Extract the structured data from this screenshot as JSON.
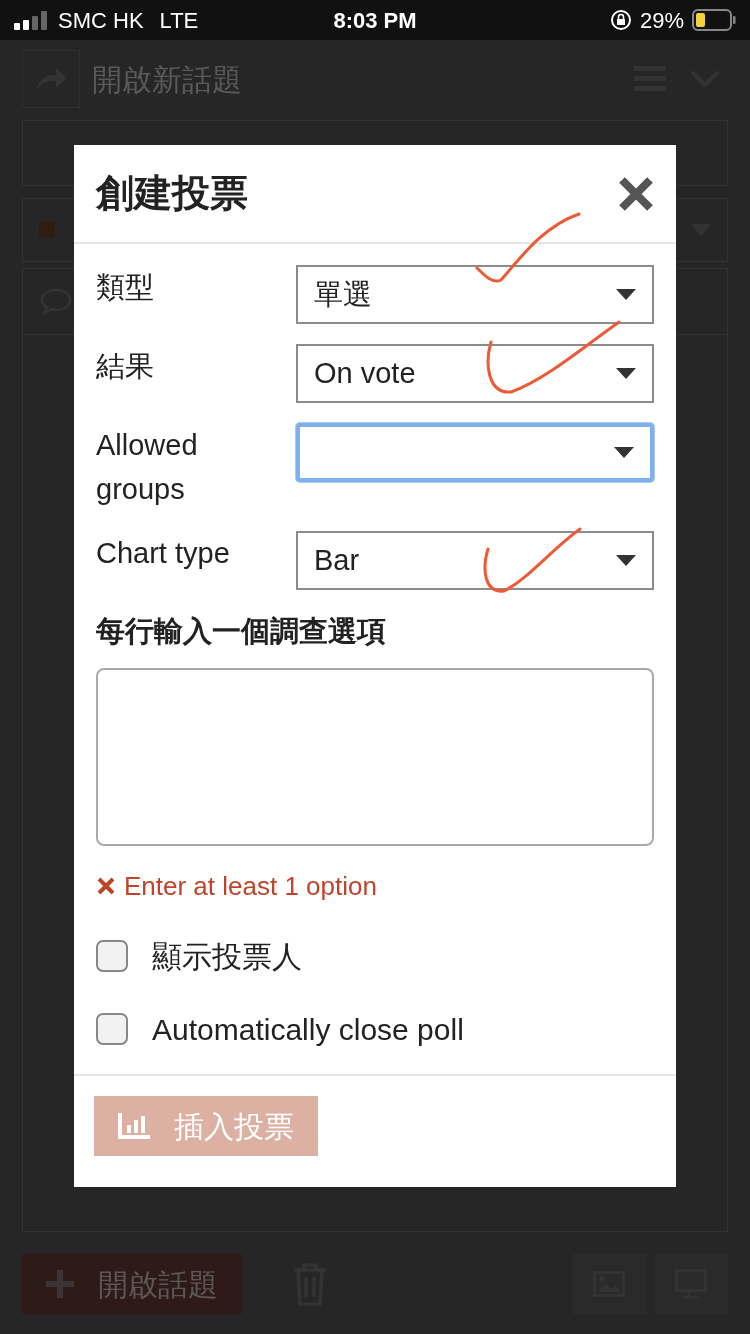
{
  "status_bar": {
    "carrier": "SMC HK",
    "network": "LTE",
    "time": "8:03 PM",
    "battery": "29%"
  },
  "background": {
    "title": "開啟新話題",
    "create_button": "開啟話題"
  },
  "dialog": {
    "title": "創建投票",
    "fields": [
      {
        "label": "類型",
        "value": "單選",
        "focused": false
      },
      {
        "label": "結果",
        "value": "On vote",
        "focused": false
      },
      {
        "label": "Allowed groups",
        "focused": true
      },
      {
        "label": "Chart type",
        "value": "Bar",
        "focused": false
      }
    ],
    "options_label": "每行輸入一個調查選項",
    "error": "Enter at least 1 option",
    "checkboxes": [
      {
        "label": "顯示投票人",
        "checked": false
      },
      {
        "label": "Automatically close poll",
        "checked": false
      }
    ],
    "submit": {
      "label": "插入投票",
      "disabled": true
    }
  }
}
